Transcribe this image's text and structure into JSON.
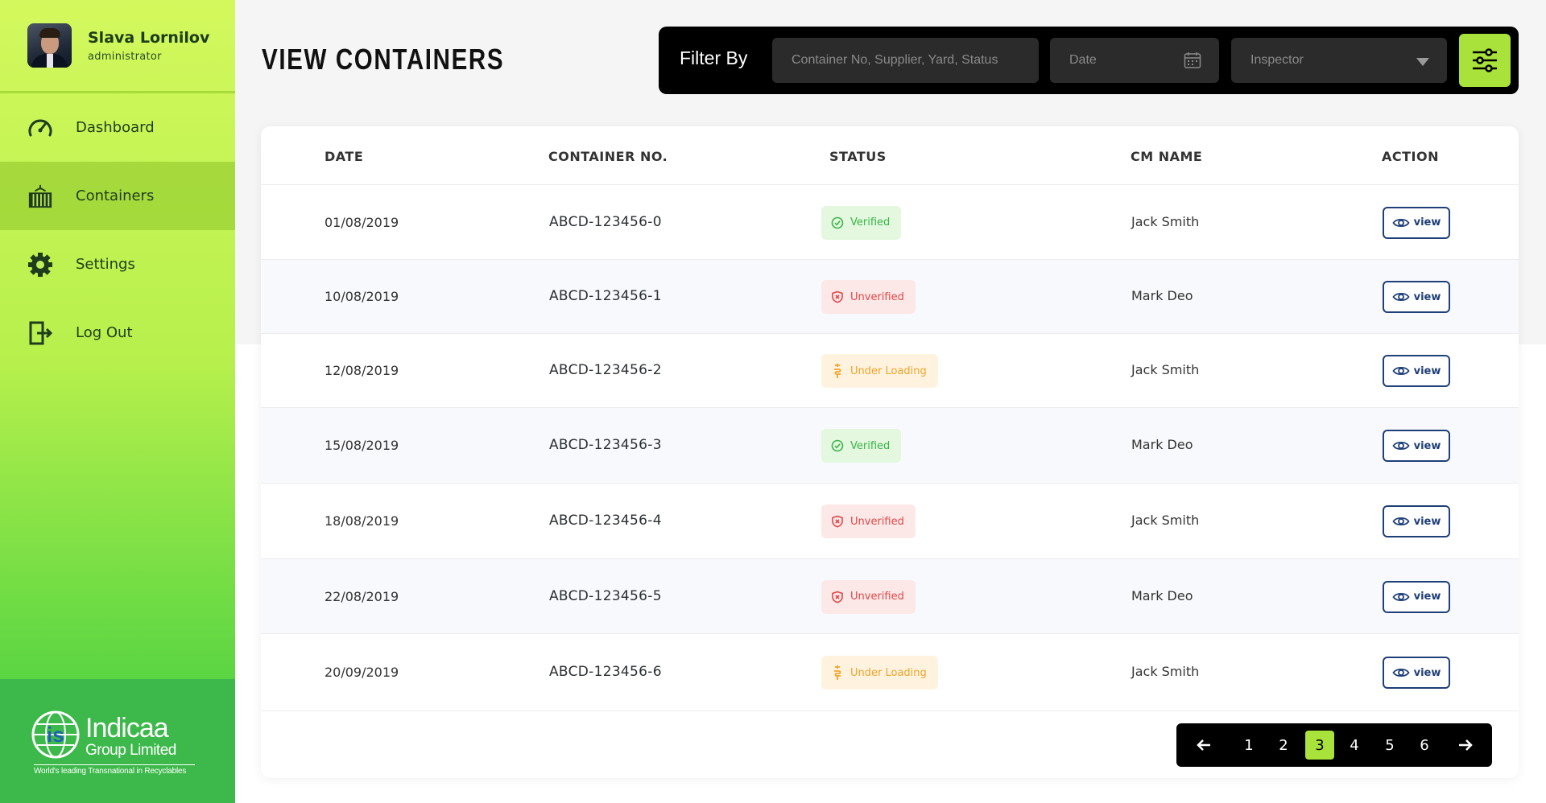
{
  "profile": {
    "name": "Slava Lornilov",
    "role": "administrator"
  },
  "nav": [
    {
      "label": "Dashboard",
      "icon": "speedometer-icon"
    },
    {
      "label": "Containers",
      "icon": "container-icon",
      "active": true
    },
    {
      "label": "Settings",
      "icon": "gear-icon"
    },
    {
      "label": "Log Out",
      "icon": "logout-icon"
    }
  ],
  "logo": {
    "name": "Indicaa",
    "sub": "Group Limited",
    "tagline": "World's leading Transnational in Recyclables"
  },
  "page": {
    "title": "VIEW CONTAINERS"
  },
  "filter": {
    "label": "Filter By",
    "search_placeholder": "Container No, Supplier, Yard, Status",
    "date_placeholder": "Date",
    "inspector_placeholder": "Inspector"
  },
  "table": {
    "headers": {
      "date": "DATE",
      "container": "CONTAINER NO.",
      "status": "STATUS",
      "cm": "CM NAME",
      "action": "ACTION"
    },
    "view_label": "view",
    "rows": [
      {
        "date": "01/08/2019",
        "container": "ABCD-123456-0",
        "status": "Verified",
        "cm": "Jack Smith"
      },
      {
        "date": "10/08/2019",
        "container": "ABCD-123456-1",
        "status": "Unverified",
        "cm": "Mark Deo"
      },
      {
        "date": "12/08/2019",
        "container": "ABCD-123456-2",
        "status": "Under Loading",
        "cm": "Jack Smith"
      },
      {
        "date": "15/08/2019",
        "container": "ABCD-123456-3",
        "status": "Verified",
        "cm": "Mark Deo"
      },
      {
        "date": "18/08/2019",
        "container": "ABCD-123456-4",
        "status": "Unverified",
        "cm": "Jack Smith"
      },
      {
        "date": "22/08/2019",
        "container": "ABCD-123456-5",
        "status": "Unverified",
        "cm": "Mark Deo"
      },
      {
        "date": "20/09/2019",
        "container": "ABCD-123456-6",
        "status": "Under Loading",
        "cm": "Jack Smith"
      }
    ]
  },
  "pagination": {
    "pages": [
      "1",
      "2",
      "3",
      "4",
      "5",
      "6"
    ],
    "current": "3"
  },
  "colors": {
    "accent": "#a9e23a",
    "verified": "#3bb44a",
    "unverified": "#e04848",
    "loading": "#f0a42a",
    "view_border": "#1f3f78"
  }
}
